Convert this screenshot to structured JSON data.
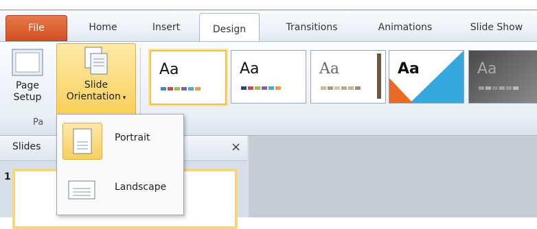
{
  "tabs": [
    {
      "label": "File"
    },
    {
      "label": "Home"
    },
    {
      "label": "Insert"
    },
    {
      "label": "Design"
    },
    {
      "label": "Transitions"
    },
    {
      "label": "Animations"
    },
    {
      "label": "Slide Show"
    }
  ],
  "ribbon": {
    "page_setup_line1": "Page",
    "page_setup_line2": "Setup",
    "orientation_line1": "Slide",
    "orientation_line2": "Orientation",
    "group_label": "Pa",
    "theme_sample": "Aa"
  },
  "slides_pane": {
    "tab_label": "Slides",
    "close": "×",
    "thumb_number": "1"
  },
  "dropdown": {
    "items": [
      {
        "label": "Portrait"
      },
      {
        "label": "Landscape"
      }
    ]
  },
  "colors": {
    "file_tab": "#d24f21",
    "highlight": "#f9cf5a",
    "selected_border": "#f1c048"
  }
}
